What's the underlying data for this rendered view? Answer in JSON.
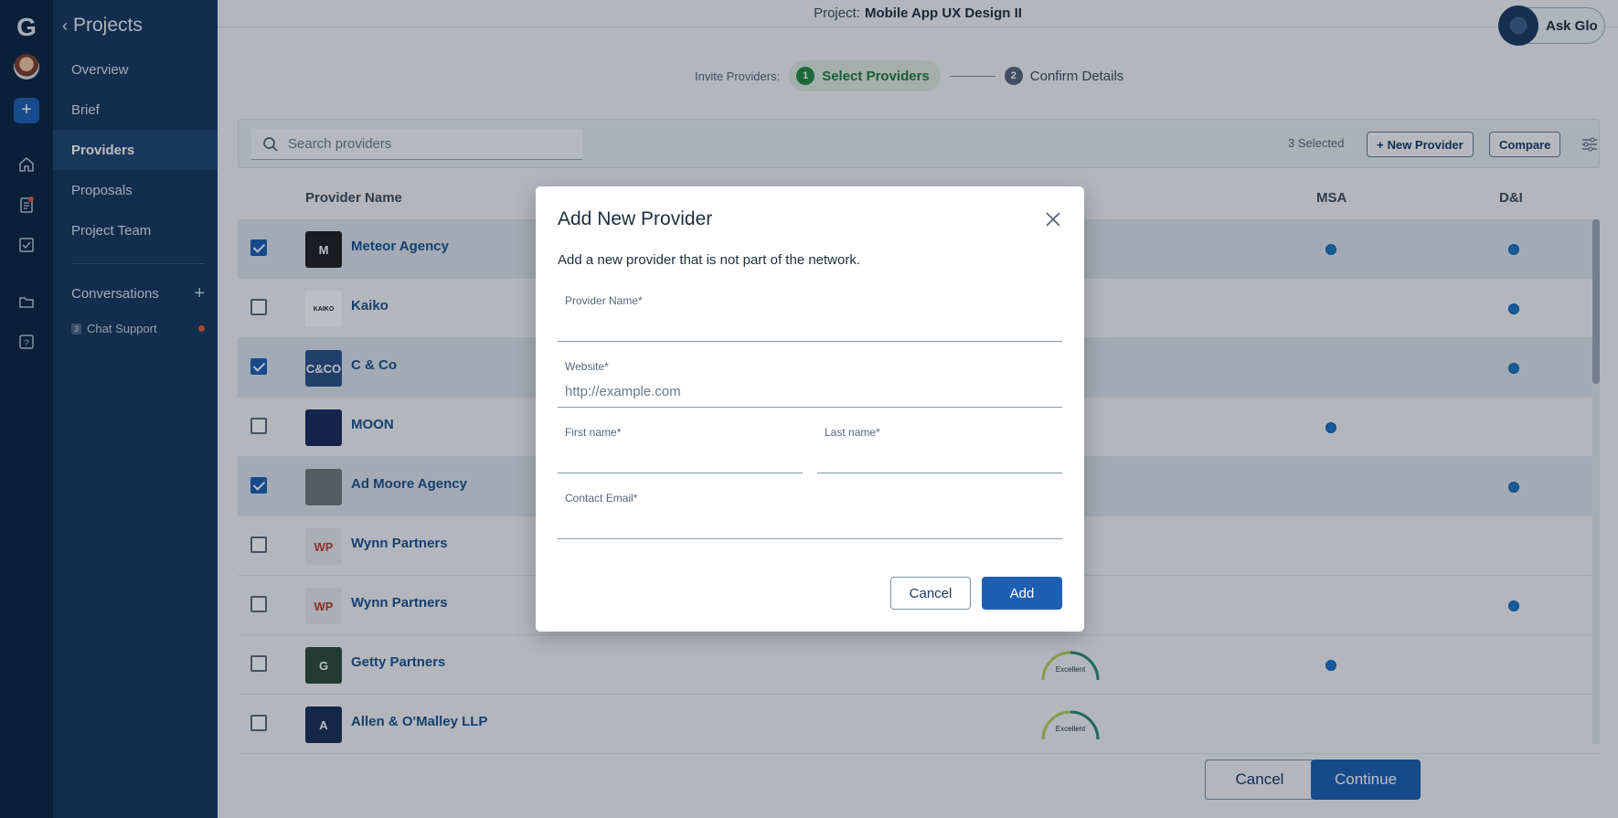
{
  "app": {
    "logo_letter": "G"
  },
  "nav": {
    "back_label": "Projects",
    "items": [
      {
        "label": "Overview"
      },
      {
        "label": "Brief"
      },
      {
        "label": "Providers"
      },
      {
        "label": "Proposals"
      },
      {
        "label": "Project Team"
      }
    ],
    "conversations_label": "Conversations",
    "chat_support": {
      "count": "3",
      "label": "Chat Support"
    }
  },
  "topbar": {
    "project_prefix": "Project:",
    "project_name": "Mobile App UX Design II",
    "ask_glo": "Ask Glo"
  },
  "stepper": {
    "label": "Invite Providers:",
    "steps": [
      {
        "num": "1",
        "label": "Select Providers"
      },
      {
        "num": "2",
        "label": "Confirm Details"
      }
    ]
  },
  "toolbar": {
    "search_placeholder": "Search providers",
    "selected_count": "3 Selected",
    "new_provider": "New Provider",
    "compare": "Compare"
  },
  "table": {
    "columns": {
      "name": "Provider Name",
      "msa": "MSA",
      "di": "D&I"
    },
    "rows": [
      {
        "name": "Meteor Agency",
        "logo_text": "M",
        "logo_bg": "#1f1f1f",
        "checked": true,
        "msa": true,
        "di": true,
        "rating": ""
      },
      {
        "name": "Kaiko",
        "logo_text": "KAIKO",
        "logo_bg": "#ffffff",
        "checked": false,
        "msa": false,
        "di": true,
        "rating": ""
      },
      {
        "name": "C & Co",
        "logo_text": "C&CO",
        "logo_bg": "#2a4f86",
        "checked": true,
        "msa": false,
        "di": true,
        "rating": ""
      },
      {
        "name": "MOON",
        "logo_text": "",
        "logo_bg": "#1b2a5a",
        "checked": false,
        "msa": true,
        "di": false,
        "rating": ""
      },
      {
        "name": "Ad Moore Agency",
        "logo_text": "",
        "logo_bg": "#6f7a7a",
        "checked": true,
        "msa": false,
        "di": true,
        "rating": ""
      },
      {
        "name": "Wynn Partners",
        "logo_text": "WP",
        "logo_bg": "#e9e9ec",
        "checked": false,
        "msa": false,
        "di": false,
        "rating": ""
      },
      {
        "name": "Wynn Partners",
        "logo_text": "WP",
        "logo_bg": "#e9e9ec",
        "checked": false,
        "msa": false,
        "di": true,
        "rating": ""
      },
      {
        "name": "Getty Partners",
        "logo_text": "G",
        "logo_bg": "#2f4a3a",
        "checked": false,
        "msa": true,
        "di": false,
        "rating": "Excellent"
      },
      {
        "name": "Allen & O'Malley LLP",
        "logo_text": "A",
        "logo_bg": "#1a2e55",
        "checked": false,
        "msa": false,
        "di": false,
        "rating": "Excellent"
      }
    ]
  },
  "footer": {
    "cancel": "Cancel",
    "continue": "Continue"
  },
  "modal": {
    "title": "Add New Provider",
    "description": "Add a new provider that is not part of the network.",
    "fields": {
      "provider_name": {
        "label": "Provider Name",
        "value": "",
        "placeholder": ""
      },
      "website": {
        "label": "Website",
        "value": "",
        "placeholder": "http://example.com"
      },
      "first_name": {
        "label": "First name",
        "value": "",
        "placeholder": ""
      },
      "last_name": {
        "label": "Last name",
        "value": "",
        "placeholder": ""
      },
      "contact_email": {
        "label": "Contact Email",
        "value": "",
        "placeholder": ""
      }
    },
    "required_marker": "*",
    "cancel": "Cancel",
    "add": "Add"
  },
  "colors": {
    "rail": "#0b2341",
    "nav": "#16365e",
    "accent": "#1d5fb2",
    "success": "#1f8a42"
  },
  "icons": [
    "logo-icon",
    "home-icon",
    "document-icon",
    "checklist-icon",
    "folder-icon",
    "help-icon",
    "search-icon",
    "filter-tune-icon",
    "close-icon",
    "plus-icon"
  ]
}
